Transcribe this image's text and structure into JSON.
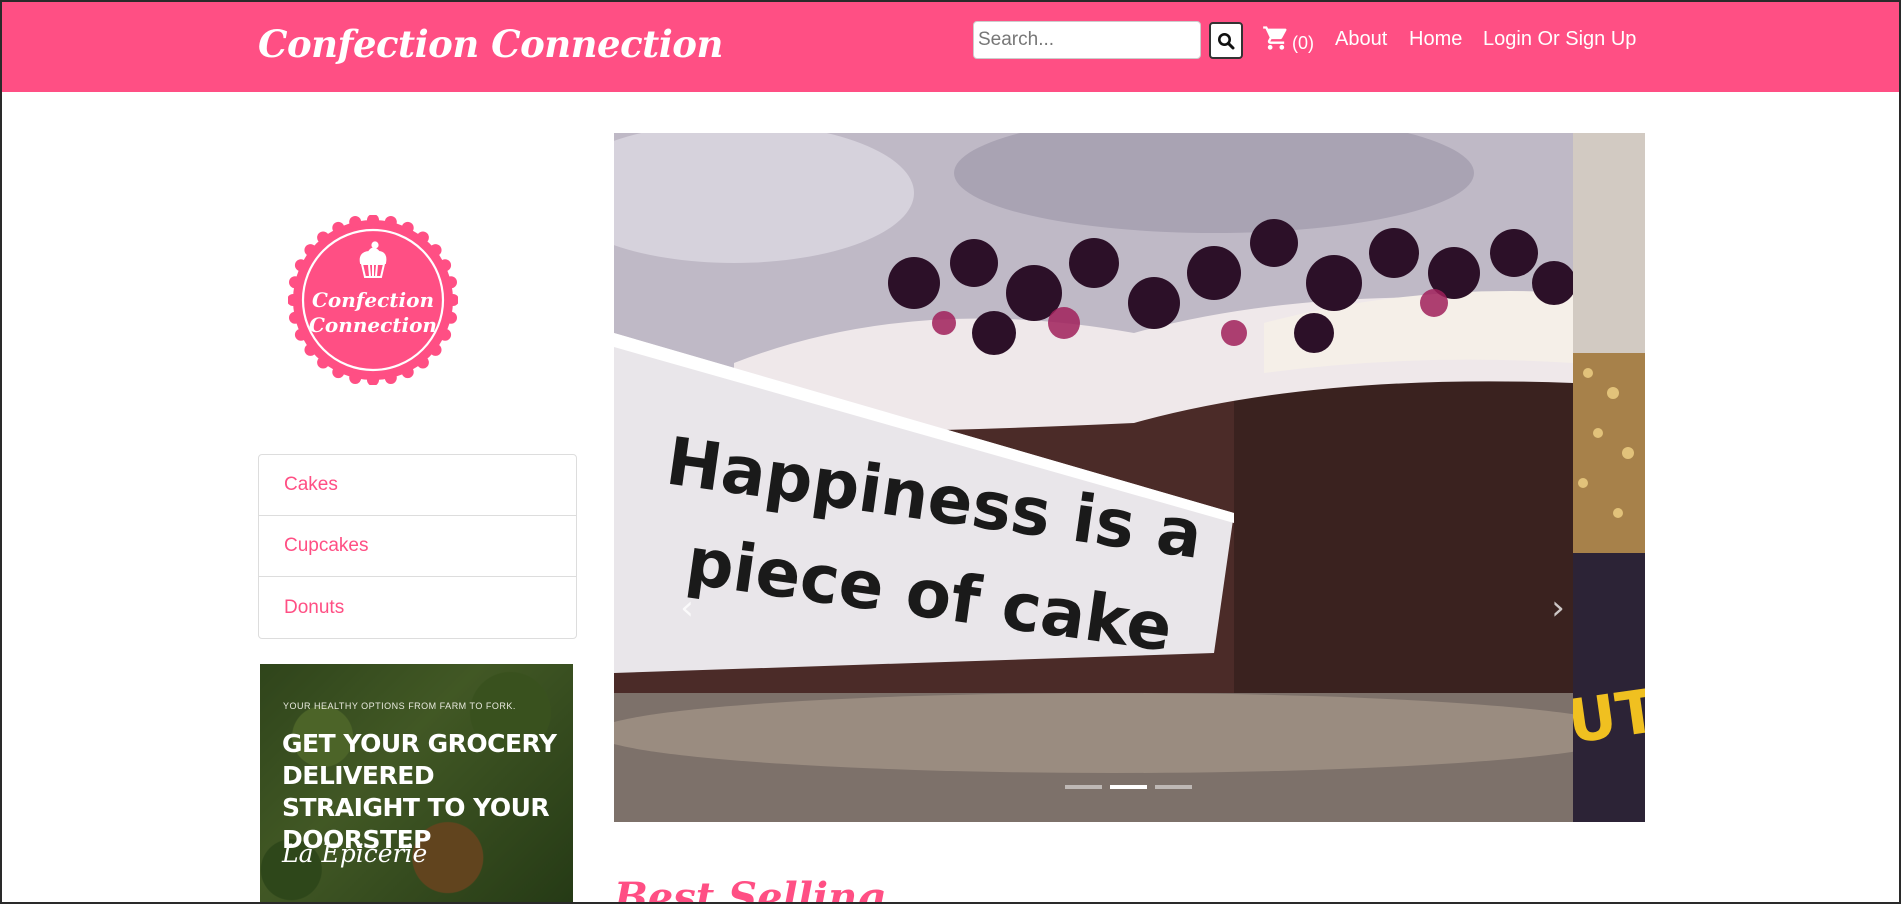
{
  "header": {
    "brand": "Confection Connection",
    "search_placeholder": "Search...",
    "cart_count": "(0)",
    "links": [
      "About",
      "Home",
      "Login Or Sign Up"
    ]
  },
  "logo": {
    "line1": "Confection",
    "line2": "Connection"
  },
  "sidebar": {
    "categories": [
      "Cakes",
      "Cupcakes",
      "Donuts"
    ]
  },
  "ad": {
    "tagline": "YOUR HEALTHY OPTIONS FROM FARM TO FORK.",
    "headline": "GET YOUR GROCERY DELIVERED STRAIGHT TO YOUR DOORSTEP",
    "brand": "La Epicerie"
  },
  "carousel": {
    "slide_text_line1": "Happiness is a",
    "slide_text_line2": "piece of cake",
    "next_slide_text": "UT",
    "indicator_count": 3,
    "active_index": 1
  },
  "main": {
    "section_title": "Best Selling"
  },
  "colors": {
    "brand_pink": "#ff4f84"
  }
}
